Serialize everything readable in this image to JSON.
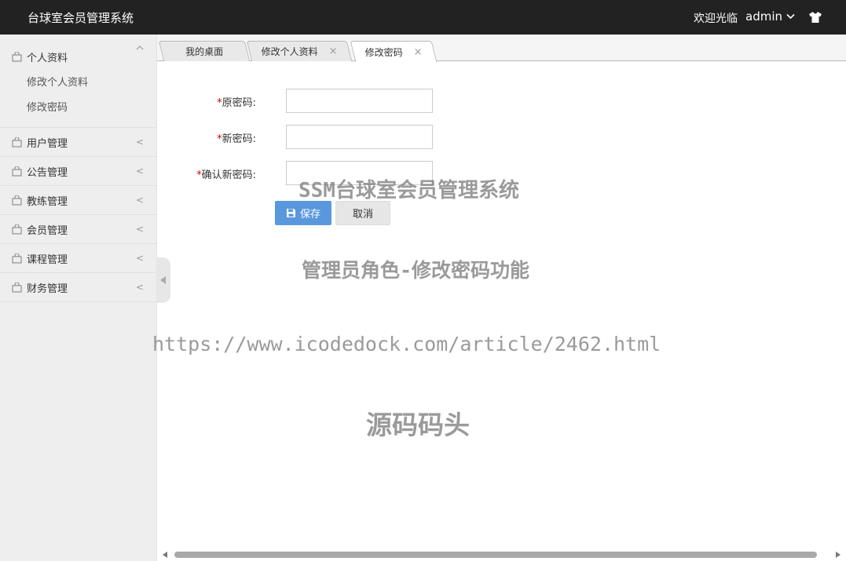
{
  "header": {
    "title": "台球室会员管理系统",
    "welcome": "欢迎光临",
    "username": "admin",
    "theme_icon": "tshirt-icon"
  },
  "sidebar": {
    "groups": [
      {
        "label": "个人资料",
        "expanded": true,
        "items": [
          "修改个人资料",
          "修改密码"
        ]
      },
      {
        "label": "用户管理",
        "expanded": false
      },
      {
        "label": "公告管理",
        "expanded": false
      },
      {
        "label": "教练管理",
        "expanded": false
      },
      {
        "label": "会员管理",
        "expanded": false
      },
      {
        "label": "课程管理",
        "expanded": false
      },
      {
        "label": "财务管理",
        "expanded": false
      }
    ],
    "collapsed_arrow": "<"
  },
  "tabs": [
    {
      "label": "我的桌面",
      "closable": false,
      "active": false
    },
    {
      "label": "修改个人资料",
      "closable": true,
      "active": false
    },
    {
      "label": "修改密码",
      "closable": true,
      "active": true
    }
  ],
  "form": {
    "required_mark": "*",
    "fields": [
      {
        "label": "原密码:",
        "value": ""
      },
      {
        "label": "新密码:",
        "value": ""
      },
      {
        "label": "确认新密码:",
        "value": ""
      }
    ],
    "save_label": "保存",
    "cancel_label": "取消"
  },
  "watermarks": {
    "line1": "SSM台球室会员管理系统",
    "line2": "管理员角色-修改密码功能",
    "line3": "https://www.icodedock.com/article/2462.html",
    "line4": "源码码头"
  },
  "colors": {
    "header_bg": "#222222",
    "sidebar_bg": "#eeeeee",
    "primary_button": "#5a98de",
    "required": "#cc0000"
  }
}
